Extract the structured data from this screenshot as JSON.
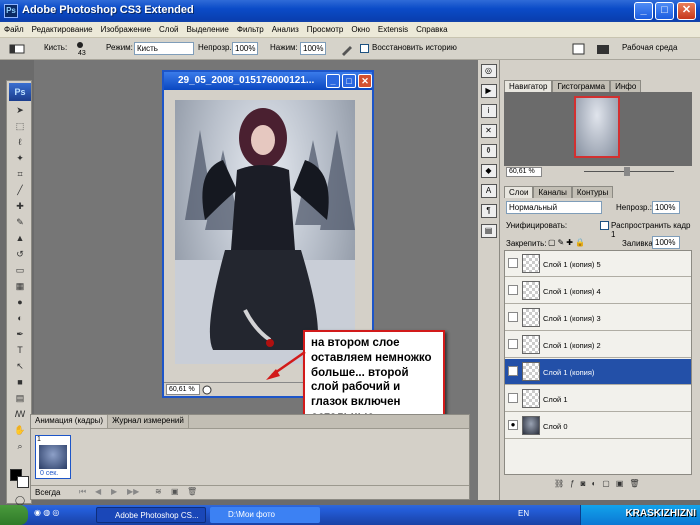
{
  "window": {
    "title": "Adobe Photoshop CS3 Extended",
    "btn_min": "_",
    "btn_max": "□",
    "btn_close": "✕"
  },
  "menu": [
    "Файл",
    "Редактирование",
    "Изображение",
    "Слой",
    "Выделение",
    "Фильтр",
    "Анализ",
    "Просмотр",
    "Окно",
    "Extensis",
    "Справка"
  ],
  "options": {
    "brush_label": "Кисть:",
    "brush_size": "43",
    "mode_label": "Режим:",
    "mode_value": "Кисть",
    "opacity_label": "Непрозр.:",
    "opacity_value": "100%",
    "pressure_label": "Нажим:",
    "pressure_value": "100%",
    "restore_history": "Восстановить историю",
    "workspace": "Рабочая среда"
  },
  "tools": {
    "logo": "Ps"
  },
  "document": {
    "title": "29_05_2008_015176000121...",
    "zoom": "60,61 %"
  },
  "annotation": {
    "text": "на втором слое оставляем немножко больше... второй слой рабочий и глазок включен остальные отключены"
  },
  "animation": {
    "tab_active": "Анимация (кадры)",
    "tab_other": "Журнал измерений",
    "frame_number": "1",
    "frame_delay": "0 сек.",
    "loop": "Всегда"
  },
  "navigator": {
    "tabs": [
      "Навигатор",
      "Гистограмма",
      "Инфо"
    ],
    "zoom": "60,61 %"
  },
  "layers_panel": {
    "tabs": [
      "Слои",
      "Каналы",
      "Контуры"
    ],
    "blend_mode": "Нормальный",
    "opacity_label": "Непрозр.:",
    "opacity_value": "100%",
    "unify_label": "Унифицировать:",
    "propagate": "Распространить кадр 1",
    "lock_label": "Закрепить:",
    "fill_label": "Заливка:",
    "fill_value": "100%",
    "layers": [
      {
        "name": "Слой 1 (копия) 5",
        "visible": false,
        "selected": false
      },
      {
        "name": "Слой 1 (копия) 4",
        "visible": false,
        "selected": false
      },
      {
        "name": "Слой 1 (копия) 3",
        "visible": false,
        "selected": false
      },
      {
        "name": "Слой 1 (копия) 2",
        "visible": false,
        "selected": false
      },
      {
        "name": "Слой 1 (копия)",
        "visible": true,
        "selected": true
      },
      {
        "name": "Слой 1",
        "visible": false,
        "selected": false
      },
      {
        "name": "Слой 0",
        "visible": true,
        "selected": false
      }
    ]
  },
  "taskbar": {
    "task1": "Adobe Photoshop CS...",
    "task2": "D:\\Мои фото",
    "lang": "EN",
    "watermark": "KRASKIZHIZNI"
  },
  "colors": {
    "accent": "#2350a8",
    "annotation_border": "#d21a1a"
  }
}
